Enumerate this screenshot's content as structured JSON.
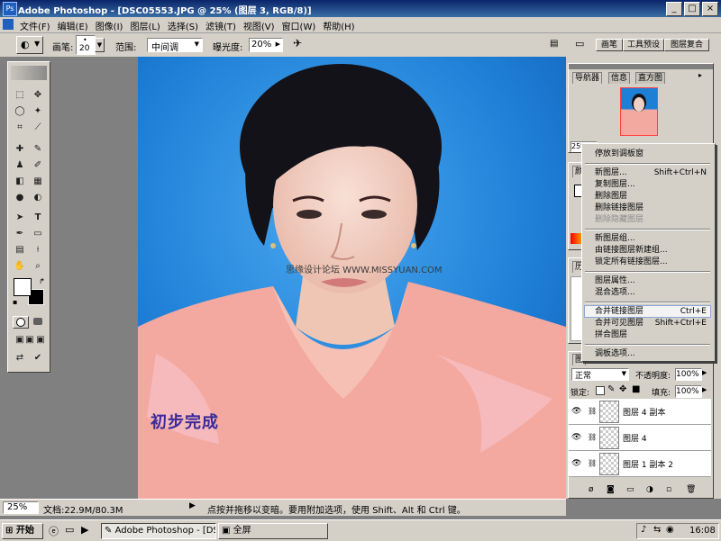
{
  "window": {
    "title": "Adobe Photoshop - [DSC05553.JPG @ 25% (图层 3, RGB/8)]",
    "minimize": "_",
    "maximize": "□",
    "close": "×"
  },
  "menu": [
    "文件(F)",
    "编辑(E)",
    "图像(I)",
    "图层(L)",
    "选择(S)",
    "滤镜(T)",
    "视图(V)",
    "窗口(W)",
    "帮助(H)"
  ],
  "options": {
    "brush_label": "画笔:",
    "brush_size": "20",
    "range_label": "范围:",
    "range_value": "中间调",
    "exposure_label": "曝光度:",
    "exposure_value": "20%",
    "palette_tabs": [
      "画笔",
      "工具预设",
      "图层复合"
    ]
  },
  "canvas": {
    "watermark": "思缘设计论坛  WWW.MISSYUAN.COM",
    "caption": "初步完成"
  },
  "status": {
    "zoom": "25%",
    "doc_size": "文档:22.9M/80.3M",
    "hint": "点按并拖移以变暗。要用附加选项，使用 Shift、Alt 和 Ctrl 键。"
  },
  "navigator": {
    "tabs": [
      "导航器",
      "信息",
      "直方图"
    ],
    "zoom": "25%"
  },
  "side_tabs": {
    "color": "颜",
    "history": "历",
    "layers": "图"
  },
  "context_menu": {
    "items": [
      {
        "label": "停放到调板窗",
        "shortcut": "",
        "disabled": false
      },
      {
        "sep": true
      },
      {
        "label": "新图层...",
        "shortcut": "Shift+Ctrl+N",
        "disabled": false
      },
      {
        "label": "复制图层...",
        "shortcut": "",
        "disabled": false
      },
      {
        "label": "删除图层",
        "shortcut": "",
        "disabled": false
      },
      {
        "label": "删除链接图层",
        "shortcut": "",
        "disabled": false
      },
      {
        "label": "删除隐藏图层",
        "shortcut": "",
        "disabled": true
      },
      {
        "sep": true
      },
      {
        "label": "新图层组...",
        "shortcut": "",
        "disabled": false
      },
      {
        "label": "由链接图层新建组...",
        "shortcut": "",
        "disabled": false
      },
      {
        "label": "锁定所有链接图层...",
        "shortcut": "",
        "disabled": false
      },
      {
        "sep": true
      },
      {
        "label": "图层属性...",
        "shortcut": "",
        "disabled": false
      },
      {
        "label": "混合选项...",
        "shortcut": "",
        "disabled": false
      },
      {
        "sep": true
      },
      {
        "label": "合并链接图层",
        "shortcut": "Ctrl+E",
        "disabled": false,
        "highlight": true
      },
      {
        "label": "合并可见图层",
        "shortcut": "Shift+Ctrl+E",
        "disabled": false
      },
      {
        "label": "拼合图层",
        "shortcut": "",
        "disabled": false
      },
      {
        "sep": true
      },
      {
        "label": "调板选项...",
        "shortcut": "",
        "disabled": false
      }
    ]
  },
  "layers_panel": {
    "blend_mode": "正常",
    "opacity_label": "不透明度:",
    "opacity": "100%",
    "lock_label": "锁定:",
    "fill_label": "填充:",
    "fill": "100%",
    "layers": [
      "图层 4 副本",
      "图层 4",
      "图层 1 副本 2"
    ]
  },
  "taskbar": {
    "start": "开始",
    "task_photoshop": "Adobe Photoshop - [DSC...",
    "task_fullscreen": "全屏",
    "clock": "16:08"
  },
  "colors": {
    "titlebar": "#0a246a",
    "chrome": "#d4d0c8",
    "photo_bg": "#1e7fd6",
    "caption": "#3a2a9a"
  }
}
